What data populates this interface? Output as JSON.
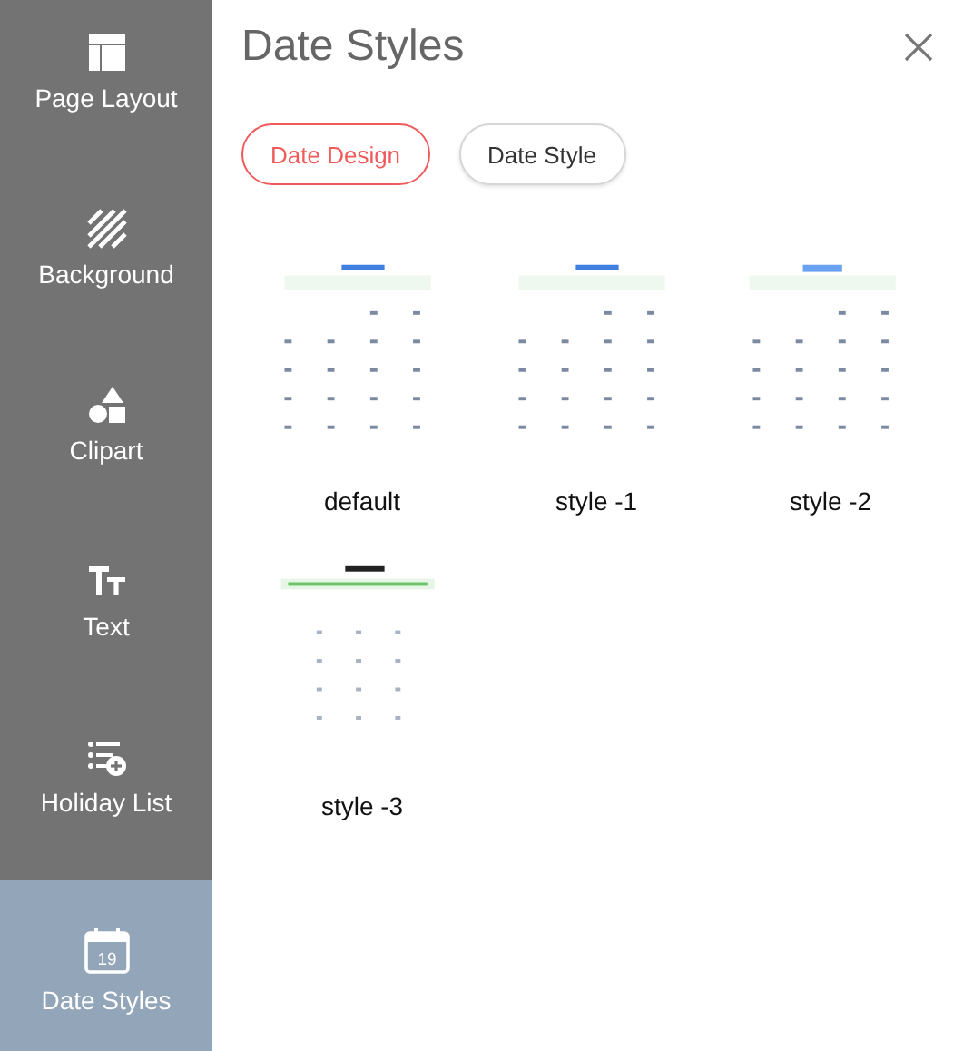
{
  "sidebar": {
    "items": [
      {
        "label": "Page Layout",
        "kind": "layout",
        "selected": false
      },
      {
        "label": "Background",
        "kind": "hatch",
        "selected": false
      },
      {
        "label": "Clipart",
        "kind": "shapes",
        "selected": false
      },
      {
        "label": "Text",
        "kind": "text",
        "selected": false
      },
      {
        "label": "Holiday List",
        "kind": "list",
        "selected": false
      },
      {
        "label": "Date Styles",
        "kind": "calendar",
        "calendar_day": "19",
        "selected": true
      }
    ]
  },
  "panel": {
    "title": "Date Styles",
    "tabs": [
      {
        "label": "Date Design",
        "selected": true
      },
      {
        "label": "Date Style",
        "selected": false
      }
    ],
    "styles": [
      {
        "label": "default",
        "kind": "standard"
      },
      {
        "label": "style -1",
        "kind": "standard"
      },
      {
        "label": "style -2",
        "kind": "sparse"
      },
      {
        "label": "style -3",
        "kind": "banner"
      }
    ]
  }
}
